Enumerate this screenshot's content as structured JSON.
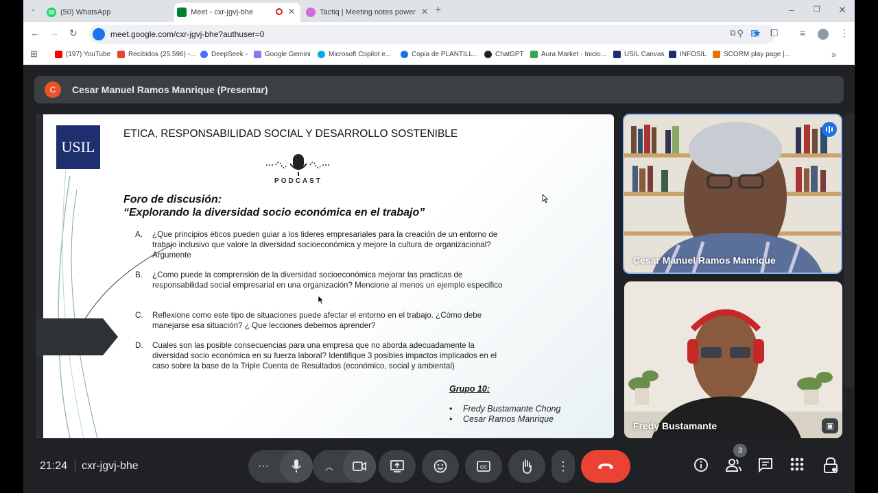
{
  "browser": {
    "tabs": [
      {
        "label": "(50) WhatsApp",
        "badge": "50",
        "color": "#25d366"
      },
      {
        "label": "Meet - cxr-jgvj-bhe",
        "color": "#00832d"
      },
      {
        "label": "Tactiq | Meeting notes powered",
        "color": "#d46ad9"
      }
    ],
    "url": "meet.google.com/cxr-jgvj-bhe?authuser=0",
    "bookmarks": [
      {
        "label": "(197) YouTube",
        "color": "#ff0000"
      },
      {
        "label": "Recibidos (25.596) -...",
        "color": "#ea4335"
      },
      {
        "label": "DeepSeek -",
        "color": "#4d6bfe"
      },
      {
        "label": "Google Gemini",
        "color": "#8e75f2"
      },
      {
        "label": "Microsoft Copilot e...",
        "color": "#0ea5e9"
      },
      {
        "label": "Copia de PLANTILL...",
        "color": "#1a73e8"
      },
      {
        "label": "ChatGPT",
        "color": "#202124"
      },
      {
        "label": "Aura Market · Inicio...",
        "color": "#34a853"
      },
      {
        "label": "USIL Canvas",
        "color": "#1d2f6e"
      },
      {
        "label": "INFOSIL",
        "color": "#1d2f6e"
      },
      {
        "label": "SCORM play page |...",
        "color": "#e37400"
      }
    ],
    "more": "»"
  },
  "meet": {
    "presenter_initial": "C",
    "presenter_label": "Cesar Manuel Ramos Manrique (Presentar)",
    "time": "21:24",
    "meeting_code": "cxr-jgvj-bhe",
    "participant_count": "3",
    "participants": [
      {
        "name": "Cesar Manuel Ramos Manrique"
      },
      {
        "name": "Fredy Bustamante"
      }
    ]
  },
  "slide": {
    "logo": "USIL",
    "title": "ETICA, RESPONSABILIDAD SOCIAL Y DESARROLLO SOSTENIBLE",
    "podcast": "PODCAST",
    "foro_line1": "Foro de discusión:",
    "foro_line2": "“Explorando la diversidad socio económica en el trabajo”",
    "questions": [
      {
        "letter": "A.",
        "text": "¿Que principios éticos pueden guiar a los lideres empresariales para la creación de un entorno de trabajo inclusivo que valore la diversidad socioeconómica y mejore la cultura de organizacional? Argumente"
      },
      {
        "letter": "B.",
        "text": "¿Como puede la comprensión de la diversidad socioeconómica mejorar las practicas de responsabilidad social empresarial en una organización? Mencione al menos un ejemplo especifico"
      },
      {
        "letter": "C.",
        "text": "Reflexione como este tipo de situaciones puede afectar el entorno en el trabajo. ¿Cómo debe manejarse esa situación? ¿ Que lecciones debemos aprender?"
      },
      {
        "letter": "D.",
        "text": "Cuales son las posible consecuencias para una empresa que no aborda adecuadamente la diversidad socio económica en su fuerza laboral? Identifique 3 posibles impactos implicados en el caso sobre la base de la Triple Cuenta de Resultados (económico, social y ambiental)"
      }
    ],
    "group_label": "Grupo 10:",
    "members": [
      "Fredy Bustamante Chong",
      "Cesar Ramos Manrique"
    ]
  }
}
